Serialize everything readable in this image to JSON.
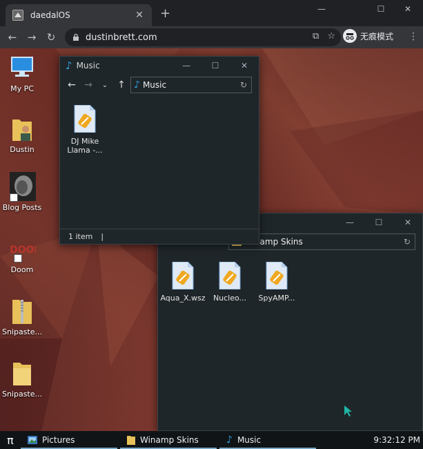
{
  "browser": {
    "tab_title": "daedalOS",
    "new_tab": "+",
    "url": "dustinbrett.com",
    "incognito_label": "无痕模式",
    "controls": {
      "minimize": "—",
      "maximize": "☐",
      "close": "✕"
    }
  },
  "desktop": {
    "icons": [
      {
        "label": "My PC",
        "icon": "computer-icon"
      },
      {
        "label": "Dustin",
        "icon": "user-folder-icon"
      },
      {
        "label": "Blog Posts",
        "icon": "blog-shortcut-icon"
      },
      {
        "label": "Doom",
        "icon": "doom-shortcut-icon"
      },
      {
        "label": "Snipaste...",
        "icon": "zip-folder-icon"
      },
      {
        "label": "Snipaste...",
        "icon": "folder-icon"
      }
    ]
  },
  "music_window": {
    "title": "Music",
    "address": "Music",
    "files": [
      {
        "name_line1": "DJ Mike",
        "name_line2": "Llama -..."
      }
    ],
    "status": "1 item",
    "status_sep": "|"
  },
  "winamp_window": {
    "address": "Winamp Skins",
    "files": [
      {
        "name": "Aqua_X.wsz"
      },
      {
        "name": "Nucleo..."
      },
      {
        "name": "SpyAMP..."
      }
    ]
  },
  "taskbar": {
    "start_symbol": "π",
    "items": [
      {
        "label": "Pictures",
        "icon": "pictures-icon"
      },
      {
        "label": "Winamp Skins",
        "icon": "folder-icon"
      },
      {
        "label": "Music",
        "icon": "music-note-icon"
      }
    ],
    "clock": "9:32:12 PM"
  },
  "colors": {
    "accent": "#2f9fe0",
    "window_bg": "#1f2629",
    "taskbar_bg": "#101416",
    "cursor": "#1fb5a5"
  }
}
